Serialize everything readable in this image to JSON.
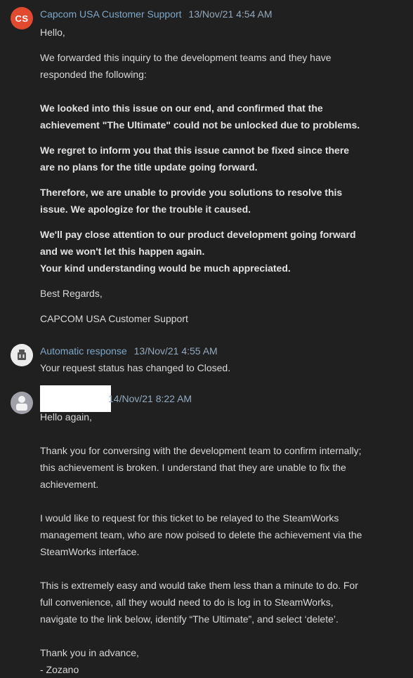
{
  "messages": [
    {
      "avatar_text": "CS",
      "avatar_icon": "capcom-support-avatar",
      "author": "Capcom USA Customer Support",
      "time": "13/Nov/21 4:54 AM",
      "greeting": "Hello,",
      "p1": "We forwarded this inquiry to the development teams and they have responded the following:",
      "b1": "We looked into this issue on our end, and confirmed that the achievement \"The Ultimate\" could not be unlocked due to problems.",
      "b2": "We regret to inform you that this issue cannot be fixed since there are no plans for the title update going forward.",
      "b3": "Therefore, we are unable to provide you solutions to resolve this issue. We apologize for the trouble it caused.",
      "b4a": "We'll pay close attention to our product development going forward and we won't let this happen again.",
      "b4b": "Your kind understanding would be much appreciated.",
      "closing": "Best Regards,",
      "signature": "CAPCOM USA Customer Support"
    },
    {
      "avatar_icon": "robot-icon",
      "author": "Automatic response",
      "time": "13/Nov/21 4:55 AM",
      "text": "Your request status has changed to Closed."
    },
    {
      "avatar_icon": "user-avatar-icon",
      "author": "",
      "time": "14/Nov/21 8:22 AM",
      "greeting": "Hello again,",
      "p1": "Thank you for conversing with the development team to confirm internally; this achievement is broken. I understand that they are unable to fix the achievement.",
      "p2": "I would like to request for this ticket to be relayed to the SteamWorks management team, who are now poised to delete the achievement via the SteamWorks interface.",
      "p3": "This is extremely easy and would take them less than a minute to do. For full convenience, all they would need to do is log in to SteamWorks, navigate to the link below, identify “The Ultimate”, and select ‘delete’.",
      "closing": "Thank you in advance,",
      "signature": "- Zozano"
    }
  ],
  "colors": {
    "background": "#202020",
    "text": "#d8d8d8",
    "author_link": "#7ea7c9",
    "timestamp": "#94a9bd",
    "cs_avatar": "#e24a2f"
  }
}
